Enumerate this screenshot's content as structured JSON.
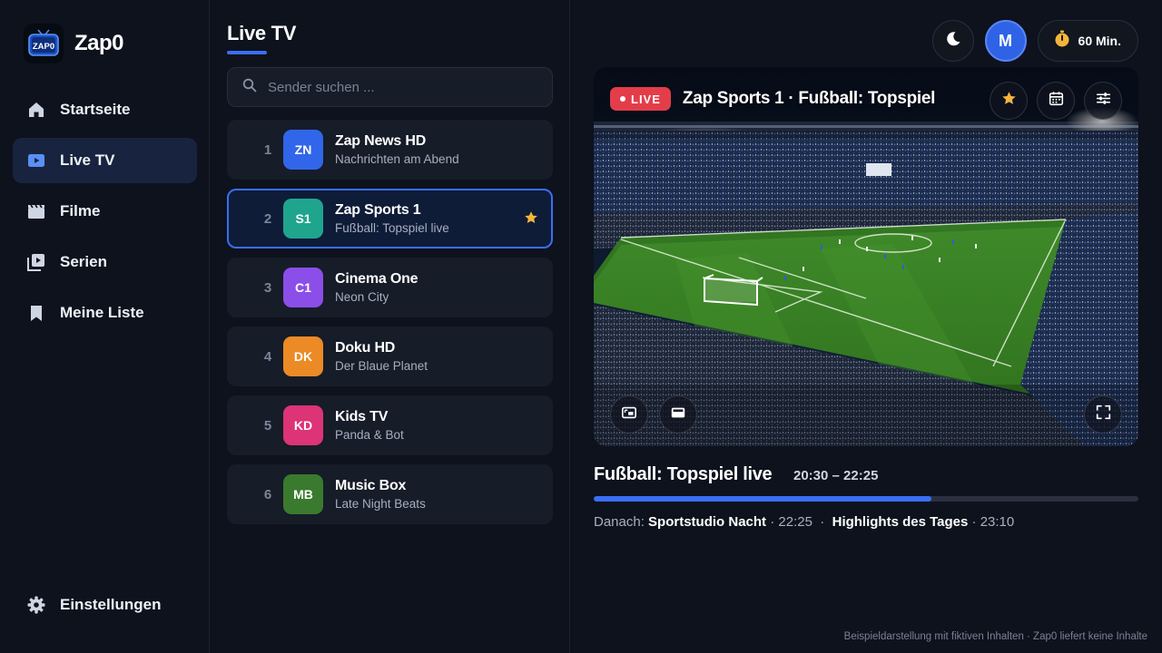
{
  "brand": {
    "name": "Zap0",
    "logo_text": "ZAP0"
  },
  "nav": {
    "items": [
      {
        "label": "Startseite",
        "icon": "home-icon"
      },
      {
        "label": "Live TV",
        "icon": "live-tv-icon",
        "active": true
      },
      {
        "label": "Filme",
        "icon": "film-icon"
      },
      {
        "label": "Serien",
        "icon": "series-icon"
      },
      {
        "label": "Meine Liste",
        "icon": "bookmark-icon"
      }
    ],
    "settings_label": "Einstellungen"
  },
  "list": {
    "title": "Live TV",
    "search_placeholder": "Sender suchen ...",
    "channels": [
      {
        "number": "1",
        "code": "ZN",
        "name": "Zap News HD",
        "program": "Nachrichten am Abend",
        "color": "#3166ea"
      },
      {
        "number": "2",
        "code": "S1",
        "name": "Zap Sports 1",
        "program": "Fußball: Topspiel live",
        "color": "#1fa58e",
        "selected": true,
        "favorite": true
      },
      {
        "number": "3",
        "code": "C1",
        "name": "Cinema One",
        "program": "Neon City",
        "color": "#8b4ee8"
      },
      {
        "number": "4",
        "code": "DK",
        "name": "Doku HD",
        "program": "Der Blaue Planet",
        "color": "#ec8a25"
      },
      {
        "number": "5",
        "code": "KD",
        "name": "Kids TV",
        "program": "Panda & Bot",
        "color": "#dc3476"
      },
      {
        "number": "6",
        "code": "MB",
        "name": "Music Box",
        "program": "Late Night Beats",
        "color": "#3a7a2e"
      }
    ]
  },
  "topbar": {
    "avatar_initial": "M",
    "timer_label": "60 Min."
  },
  "player": {
    "live_label": "LIVE",
    "title": "Zap Sports 1 · Fußball: Topspiel"
  },
  "now": {
    "title": "Fußball: Topspiel live",
    "time": "20:30 – 22:25",
    "progress": 0.62
  },
  "next": {
    "prefix": "Danach:",
    "items": [
      {
        "title": "Sportstudio Nacht",
        "time": "22:25"
      },
      {
        "title": "Highlights des Tages",
        "time": "23:10"
      }
    ]
  },
  "footer_note": "Beispieldarstellung mit fiktiven Inhalten · Zap0 liefert keine Inhalte",
  "colors": {
    "accent": "#3b6ef5",
    "live": "#e33d4a",
    "star": "#f5b53c"
  }
}
